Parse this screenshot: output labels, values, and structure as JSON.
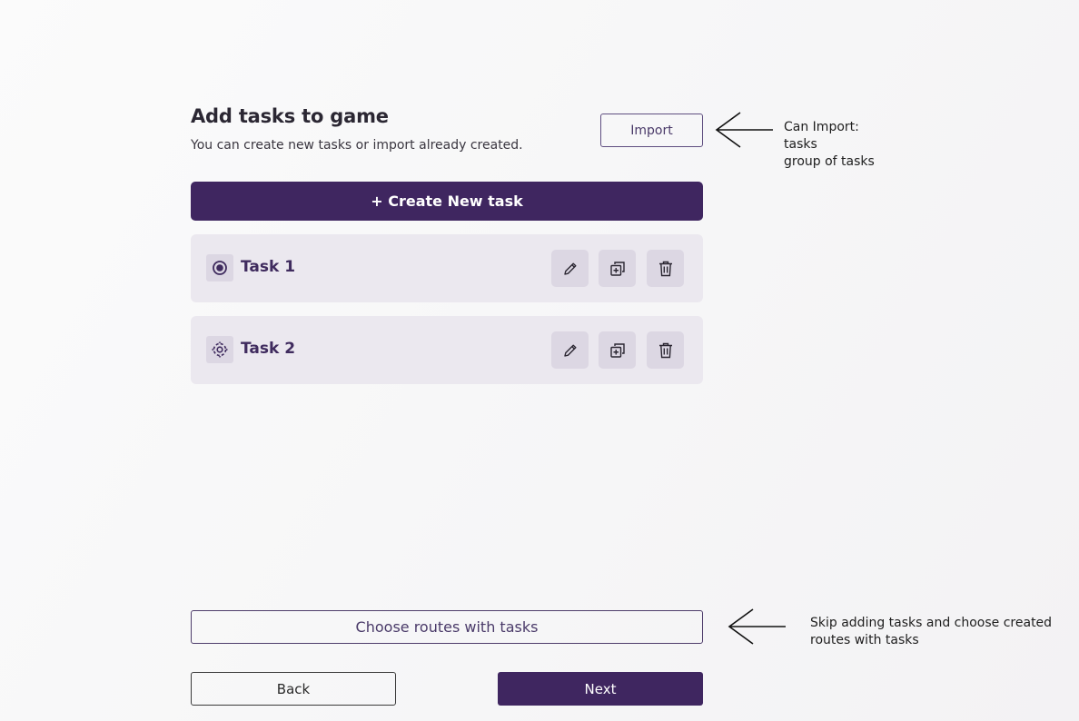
{
  "header": {
    "title": "Add tasks to game",
    "subtitle": "You can create new tasks or import already created.",
    "import_label": "Import"
  },
  "create_button_label": "+ Create New task",
  "tasks": [
    {
      "name": "Task 1",
      "icon": "radio-target-icon"
    },
    {
      "name": "Task 2",
      "icon": "move-target-icon"
    }
  ],
  "task_actions": {
    "edit": "pencil-icon",
    "duplicate": "duplicate-icon",
    "delete": "trash-icon"
  },
  "footer": {
    "routes_label": "Choose routes with tasks",
    "back_label": "Back",
    "next_label": "Next"
  },
  "annotations": {
    "import_note": [
      "Can Import:",
      "tasks",
      "group of tasks"
    ],
    "routes_note": [
      "Skip adding tasks and choose created",
      "routes with tasks"
    ]
  },
  "colors": {
    "primary": "#3f2660",
    "card": "#ebe8ef",
    "icon_bg": "#dcd7e3"
  }
}
